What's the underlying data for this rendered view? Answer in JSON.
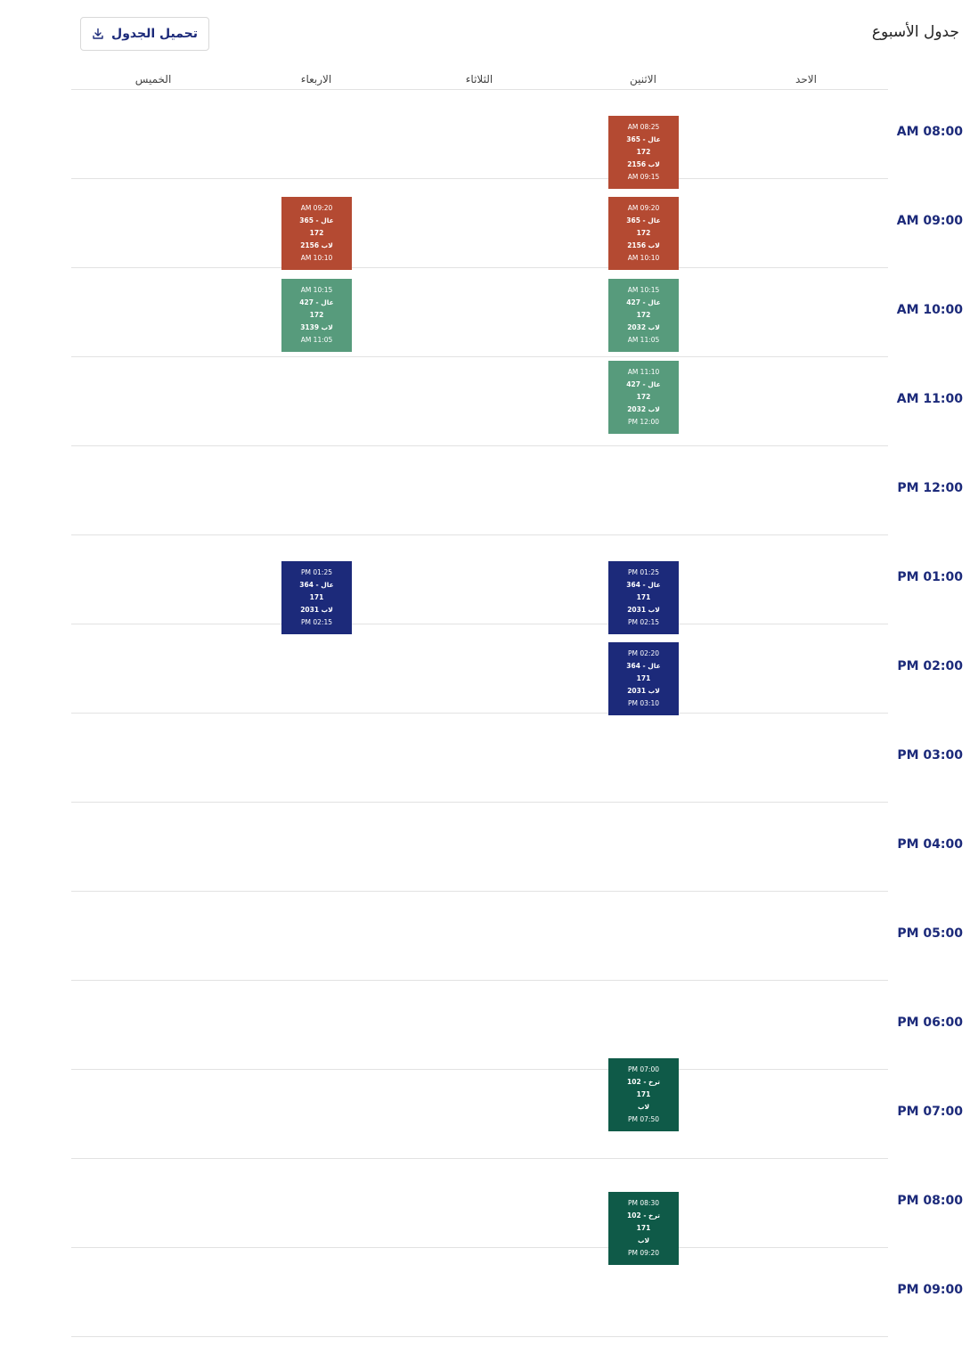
{
  "header": {
    "title": "جدول الأسبوع",
    "download_label": "تحميل الجدول",
    "download_icon": "download-icon"
  },
  "days": [
    "الاحد",
    "الاثنين",
    "الثلاثاء",
    "الاربعاء",
    "الخميس"
  ],
  "times": [
    "08:00 AM",
    "09:00 AM",
    "10:00 AM",
    "11:00 AM",
    "12:00 PM",
    "01:00 PM",
    "02:00 PM",
    "03:00 PM",
    "04:00 PM",
    "05:00 PM",
    "06:00 PM",
    "07:00 PM",
    "08:00 PM",
    "09:00 PM"
  ],
  "colors": {
    "accent": "#1c2a7a",
    "red": "#b44a32",
    "green": "#579b7c",
    "navy": "#1c2a7a",
    "darkgreen": "#0f5a48"
  },
  "events": [
    {
      "day": "الاثنين",
      "color": "red",
      "start": "08:25 AM",
      "course": "عال - 365",
      "section": "172",
      "room": "لاب 2156",
      "end": "09:15 AM"
    },
    {
      "day": "الاثنين",
      "color": "red",
      "start": "09:20 AM",
      "course": "عال - 365",
      "section": "172",
      "room": "لاب 2156",
      "end": "10:10 AM"
    },
    {
      "day": "الاربعاء",
      "color": "red",
      "start": "09:20 AM",
      "course": "عال - 365",
      "section": "172",
      "room": "لاب 2156",
      "end": "10:10 AM"
    },
    {
      "day": "الاثنين",
      "color": "green",
      "start": "10:15 AM",
      "course": "عال - 427",
      "section": "172",
      "room": "لاب 2032",
      "end": "11:05 AM"
    },
    {
      "day": "الاربعاء",
      "color": "green",
      "start": "10:15 AM",
      "course": "عال - 427",
      "section": "172",
      "room": "لاب 3139",
      "end": "11:05 AM"
    },
    {
      "day": "الاثنين",
      "color": "green",
      "start": "11:10 AM",
      "course": "عال - 427",
      "section": "172",
      "room": "لاب 2032",
      "end": "12:00 PM"
    },
    {
      "day": "الاثنين",
      "color": "navy",
      "start": "01:25 PM",
      "course": "عال - 364",
      "section": "171",
      "room": "لاب 2031",
      "end": "02:15 PM"
    },
    {
      "day": "الاربعاء",
      "color": "navy",
      "start": "01:25 PM",
      "course": "عال - 364",
      "section": "171",
      "room": "لاب 2031",
      "end": "02:15 PM"
    },
    {
      "day": "الاثنين",
      "color": "navy",
      "start": "02:20 PM",
      "course": "عال - 364",
      "section": "171",
      "room": "لاب 2031",
      "end": "03:10 PM"
    },
    {
      "day": "الاثنين",
      "color": "darkgreen",
      "start": "07:00 PM",
      "course": "ترخ - 102",
      "section": "171",
      "room": "لاب",
      "end": "07:50 PM"
    },
    {
      "day": "الاثنين",
      "color": "darkgreen",
      "start": "08:30 PM",
      "course": "ترخ - 102",
      "section": "171",
      "room": "لاب",
      "end": "09:20 PM"
    }
  ]
}
